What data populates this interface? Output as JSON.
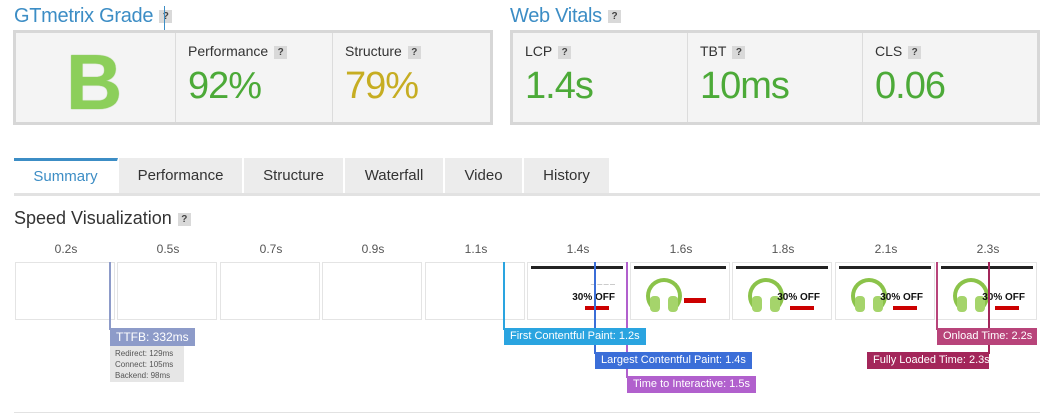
{
  "grade": {
    "title": "GTmetrix Grade",
    "letter": "B",
    "performance": {
      "label": "Performance",
      "value": "92%",
      "color": "#4caa38"
    },
    "structure": {
      "label": "Structure",
      "value": "79%",
      "color": "#c6ad22"
    }
  },
  "vitals": {
    "title": "Web Vitals",
    "lcp": {
      "label": "LCP",
      "value": "1.4s",
      "color": "#4caa38"
    },
    "tbt": {
      "label": "TBT",
      "value": "10ms",
      "color": "#4caa38"
    },
    "cls": {
      "label": "CLS",
      "value": "0.06",
      "color": "#4caa38"
    }
  },
  "help_glyph": "?",
  "tabs": [
    {
      "label": "Summary",
      "active": true
    },
    {
      "label": "Performance",
      "active": false
    },
    {
      "label": "Structure",
      "active": false
    },
    {
      "label": "Waterfall",
      "active": false
    },
    {
      "label": "Video",
      "active": false
    },
    {
      "label": "History",
      "active": false
    }
  ],
  "speed": {
    "title": "Speed Visualization",
    "times": [
      "0.2s",
      "0.5s",
      "0.7s",
      "0.9s",
      "1.1s",
      "1.4s",
      "1.6s",
      "1.8s",
      "2.1s",
      "2.3s"
    ],
    "frame_promo": "30% OFF",
    "ttfb": {
      "label": "TTFB: 332ms",
      "details": [
        "Redirect: 129ms",
        "Connect: 105ms",
        "Backend: 98ms"
      ],
      "color": "#8d9bc9"
    },
    "fcp": {
      "label": "First Contentful Paint: 1.2s",
      "color": "#2aa4e0"
    },
    "lcp": {
      "label": "Largest Contentful Paint: 1.4s",
      "color": "#3b6ed8"
    },
    "tti": {
      "label": "Time to Interactive: 1.5s",
      "color": "#b160cd"
    },
    "onload": {
      "label": "Onload Time: 2.2s",
      "color": "#b8447a"
    },
    "fully_loaded": {
      "label": "Fully Loaded Time: 2.3s",
      "color": "#a3265a"
    }
  }
}
